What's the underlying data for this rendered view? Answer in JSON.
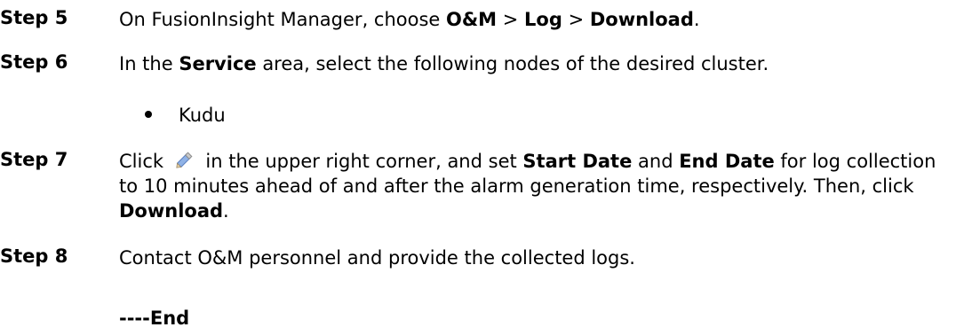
{
  "steps": [
    {
      "label": "Step 5",
      "parts": [
        "On FusionInsight Manager, choose ",
        "O&M",
        " > ",
        "Log",
        " > ",
        "Download",
        "."
      ]
    },
    {
      "label": "Step 6",
      "parts": [
        "In the ",
        "Service",
        " area, select the following nodes of the desired cluster."
      ],
      "bullets": [
        "Kudu"
      ]
    },
    {
      "label": "Step 7",
      "parts": [
        "Click ",
        " in the upper right corner, and set ",
        "Start Date",
        " and ",
        "End Date",
        " for log collection to 10 minutes ahead of and after the alarm generation time, respectively. Then, click ",
        "Download",
        "."
      ],
      "icon": "edit-pencil-icon"
    },
    {
      "label": "Step 8",
      "parts": [
        "Contact O&M personnel and provide the collected logs."
      ]
    }
  ],
  "end_marker": "----End"
}
